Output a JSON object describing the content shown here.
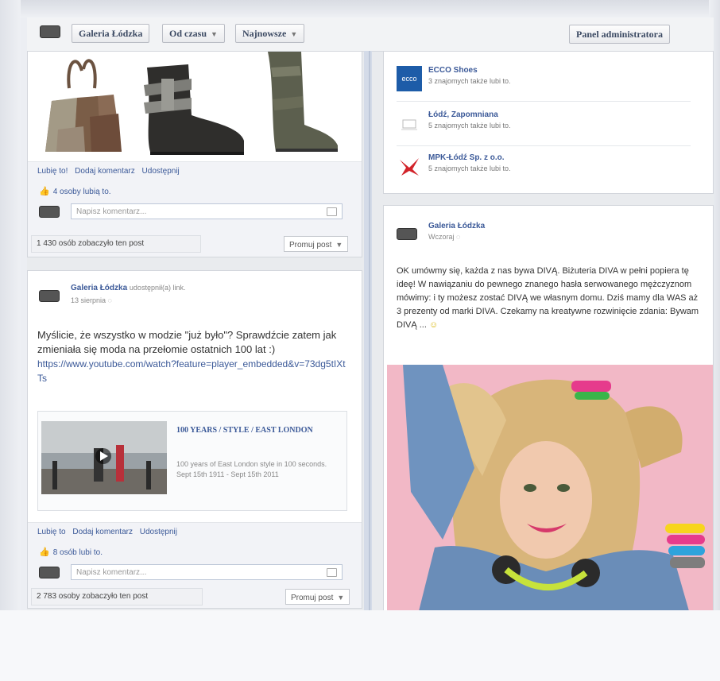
{
  "topbar": {
    "page_name": "Galeria Łódzka",
    "time_filter": "Od czasu",
    "sort_filter": "Najnowsze",
    "admin_panel": "Panel administratora"
  },
  "post1": {
    "actions": [
      "Lubię to!",
      "Dodaj komentarz",
      "Udostępnij"
    ],
    "likes": "4 osoby lubią to.",
    "comment_placeholder": "Napisz komentarz...",
    "reach": "1 430 osób zobaczyło ten post",
    "promote": "Promuj post"
  },
  "post2": {
    "author": "Galeria Łódzka",
    "author_suffix": "udostępnił(a) link.",
    "date": "13 sierpnia",
    "text": "Myślicie, że wszystko w modzie \"już było\"? Sprawdźcie zatem jak zmieniała się moda na przełomie ostatnich 100 lat :)",
    "link": "https://www.youtube.com/watch?feature=player_embedded&v=73dg5tIXtTs",
    "video_title": "100 YEARS / STYLE / EAST LONDON",
    "video_desc": "100 years of East London style in 100 seconds. Sept 15th 1911 - Sept 15th 2011",
    "actions": [
      "Lubię to",
      "Dodaj komentarz",
      "Udostępnij"
    ],
    "likes": "8 osób lubi to.",
    "comment_placeholder": "Napisz komentarz...",
    "reach": "2 783 osoby zobaczyło ten post",
    "promote": "Promuj post"
  },
  "pages": [
    {
      "name": "ECCO Shoes",
      "sub": "3 znajomych także lubi to.",
      "logo_text": "ecco"
    },
    {
      "name": "Łódź, Zapomniana",
      "sub": "5 znajomych także lubi to.",
      "logo_text": ""
    },
    {
      "name": "MPK-Łódź Sp. z o.o.",
      "sub": "5 znajomych także lubi to.",
      "logo_text": ""
    }
  ],
  "post3": {
    "author": "Galeria Łódzka",
    "date": "Wczoraj",
    "text": "OK umówmy się, każda z nas bywa DIVĄ. Biżuteria DIVA w pełni popiera tę ideę! W nawiązaniu do pewnego znanego hasła serwowanego mężczyznom mówimy: i ty możesz zostać DIVĄ we własnym domu. Dziś mamy dla WAS aż 3 prezenty od marki DIVA. Czekamy na kreatywne rozwinięcie zdania: Bywam DIVĄ ..."
  },
  "colors": {
    "link_blue": "#3b5998",
    "page_bg": "#e9ebee",
    "photo_bg": "#f2b8c6"
  }
}
